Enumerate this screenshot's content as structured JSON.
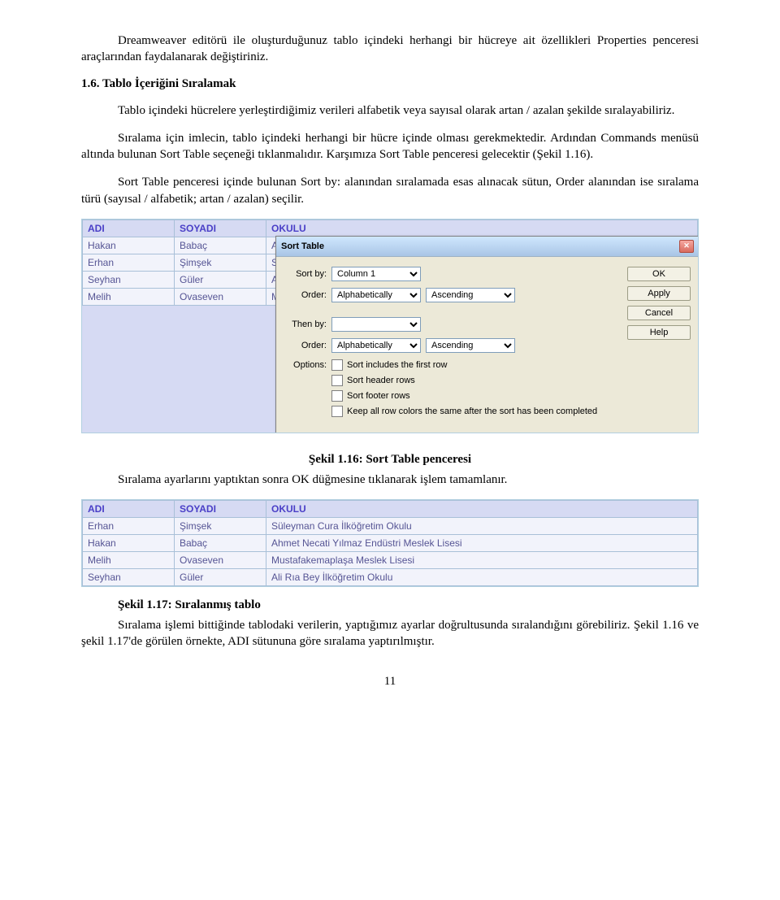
{
  "para1": "Dreamweaver editörü ile oluşturduğunuz tablo içindeki herhangi bir hücreye ait özellikleri Properties penceresi araçlarından faydalanarak değiştiriniz.",
  "section": "1.6. Tablo İçeriğini Sıralamak",
  "para2": "Tablo içindeki hücrelere yerleştirdiğimiz verileri alfabetik veya sayısal olarak artan / azalan şekilde sıralayabiliriz.",
  "para3": "Sıralama için imlecin, tablo içindeki herhangi bir hücre içinde olması gerekmektedir. Ardından Commands menüsü altında bulunan Sort Table seçeneği tıklanmalıdır. Karşımıza Sort Table penceresi gelecektir (Şekil 1.16).",
  "para4": "Sort Table penceresi içinde bulunan Sort by: alanından sıralamada esas alınacak sütun, Order alanından ise sıralama türü (sayısal / alfabetik; artan / azalan) seçilir.",
  "caption1": "Şekil 1.16: Sort Table penceresi",
  "para5": "Sıralama ayarlarını yaptıktan sonra OK düğmesine tıklanarak işlem tamamlanır.",
  "caption2": "Şekil 1.17: Sıralanmış tablo",
  "para6": "Sıralama işlemi bittiğinde tablodaki verilerin, yaptığımız ayarlar doğrultusunda sıralandığını görebiliriz. Şekil 1.16 ve şekil 1.17'de görülen örnekte, ADI sütununa göre sıralama yaptırılmıştır.",
  "pagenum": "11",
  "table1": {
    "headers": [
      "ADI",
      "SOYADI",
      "OKULU"
    ],
    "rows": [
      [
        "Hakan",
        "Babaç",
        "Ah"
      ],
      [
        "Erhan",
        "Şimşek",
        "Sü"
      ],
      [
        "Seyhan",
        "Güler",
        "Ali"
      ],
      [
        "Melih",
        "Ovaseven",
        "Mu"
      ]
    ]
  },
  "dialog": {
    "title": "Sort Table",
    "sort_by_label": "Sort by:",
    "sort_by_value": "Column 1",
    "order_label": "Order:",
    "order_type": "Alphabetically",
    "order_dir": "Ascending",
    "then_by_label": "Then by:",
    "then_by_value": "",
    "order2_type": "Alphabetically",
    "order2_dir": "Ascending",
    "options_label": "Options:",
    "opt1": "Sort includes the first row",
    "opt2": "Sort header rows",
    "opt3": "Sort footer rows",
    "opt4": "Keep all row colors the same after the sort has been completed",
    "buttons": {
      "ok": "OK",
      "apply": "Apply",
      "cancel": "Cancel",
      "help": "Help"
    }
  },
  "table2": {
    "headers": [
      "ADI",
      "SOYADI",
      "OKULU"
    ],
    "rows": [
      [
        "Erhan",
        "Şimşek",
        "Süleyman Cura İlköğretim Okulu"
      ],
      [
        "Hakan",
        "Babaç",
        "Ahmet Necati Yılmaz Endüstri Meslek Lisesi"
      ],
      [
        "Melih",
        "Ovaseven",
        "Mustafakemaplaşa Meslek Lisesi"
      ],
      [
        "Seyhan",
        "Güler",
        "Ali Rıa Bey İlköğretim Okulu"
      ]
    ]
  }
}
